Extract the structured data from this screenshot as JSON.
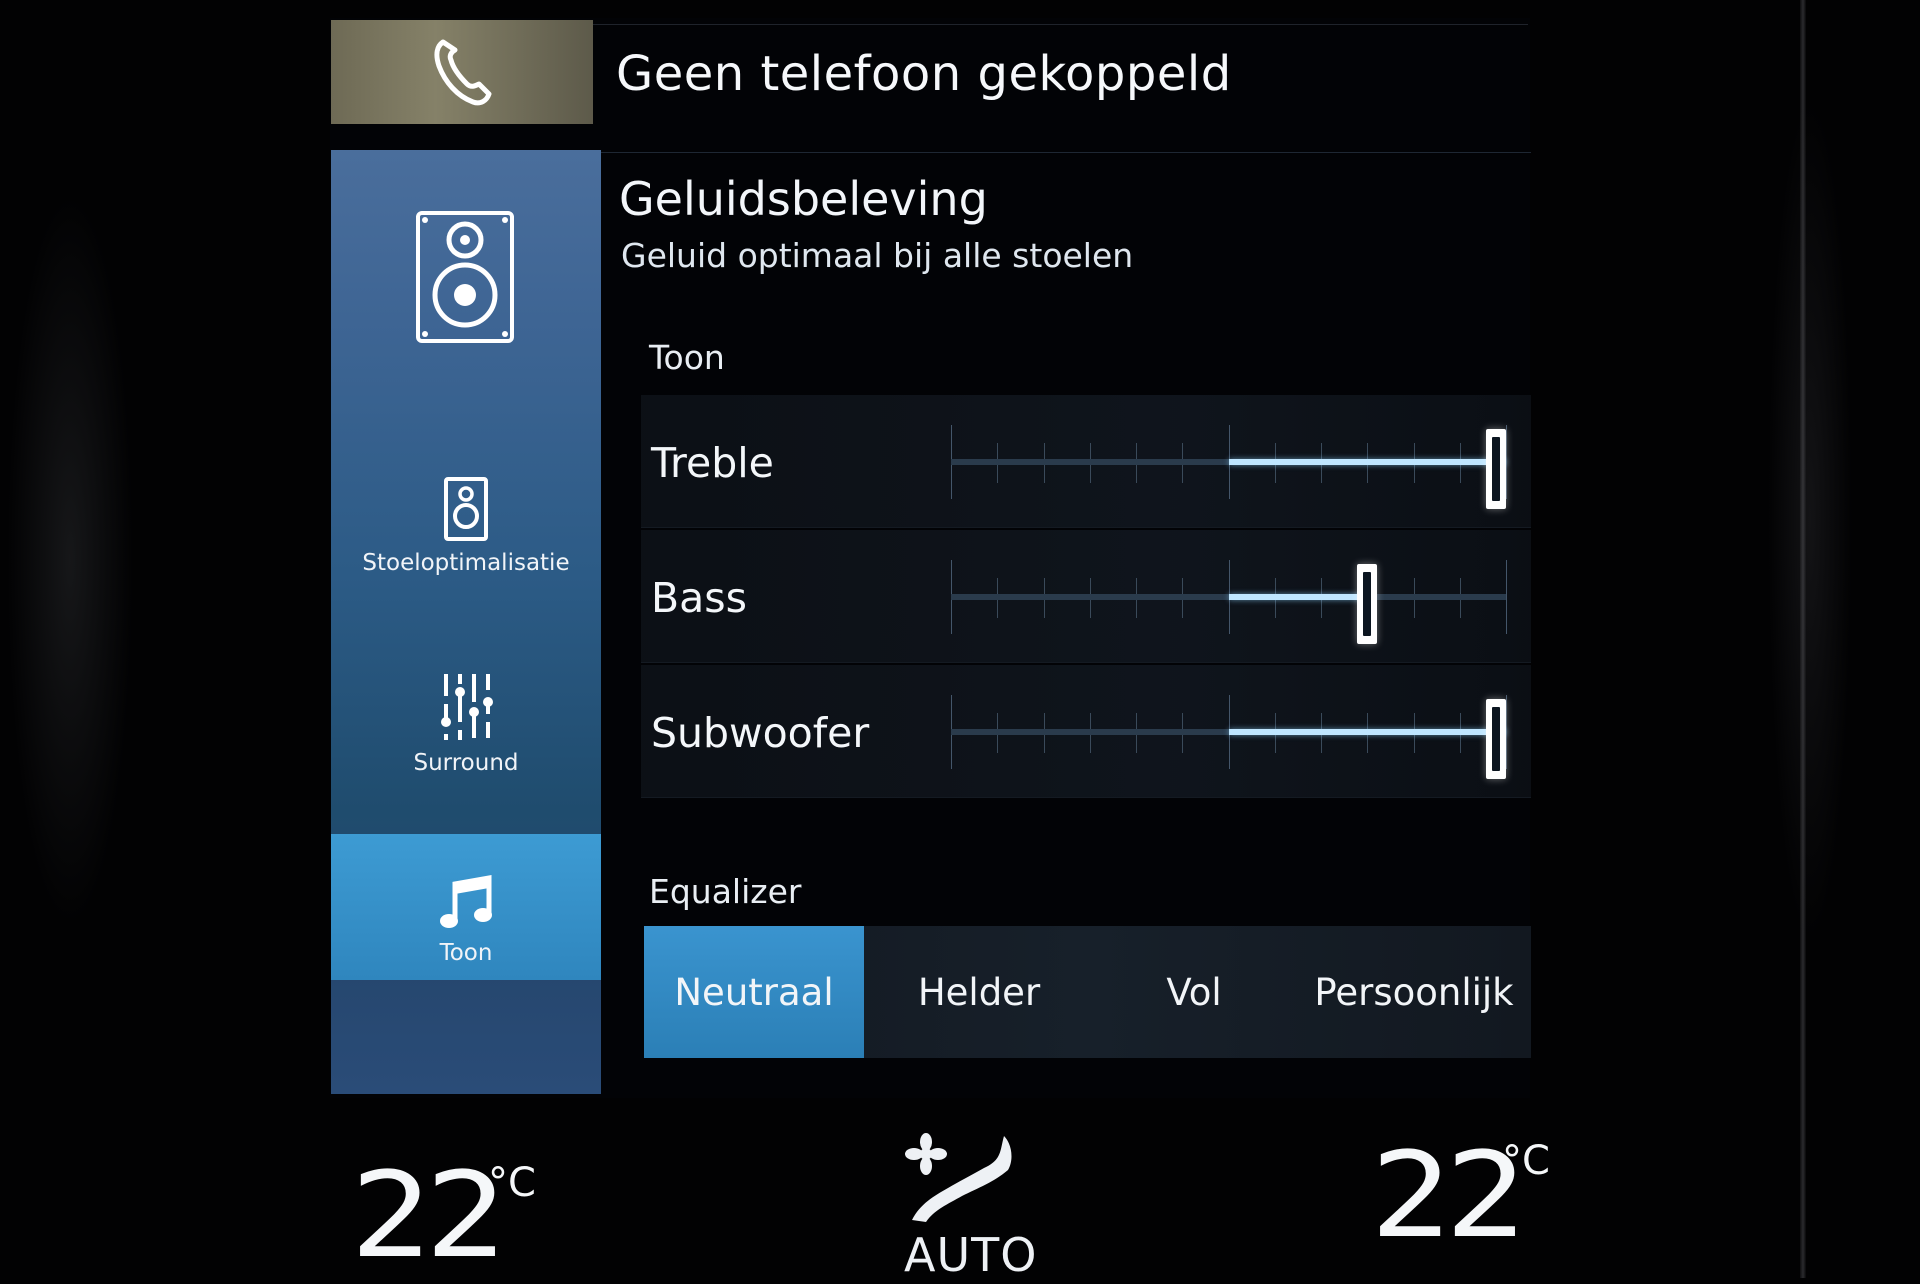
{
  "phone": {
    "status": "Geen telefoon gekoppeld",
    "icon": "phone-icon"
  },
  "nav": {
    "hero_icon": "speaker-icon",
    "items": [
      {
        "label": "Stoeloptimalisatie",
        "icon": "seat-speaker-icon",
        "active": false
      },
      {
        "label": "Surround",
        "icon": "surround-sliders-icon",
        "active": false
      },
      {
        "label": "Toon",
        "icon": "music-note-icon",
        "active": true
      }
    ]
  },
  "header": {
    "title": "Geluidsbeleving",
    "subtitle": "Geluid optimaal bij alle stoelen"
  },
  "tone": {
    "section_label": "Toon",
    "sliders": [
      {
        "label": "Treble",
        "value": 12,
        "min": -12,
        "max": 12
      },
      {
        "label": "Bass",
        "value": 6,
        "min": -12,
        "max": 12
      },
      {
        "label": "Subwoofer",
        "value": 12,
        "min": -12,
        "max": 12
      }
    ]
  },
  "equalizer": {
    "section_label": "Equalizer",
    "options": [
      "Neutraal",
      "Helder",
      "Vol",
      "Persoonlijk"
    ],
    "selected": "Neutraal"
  },
  "climate": {
    "left_temp": "22",
    "left_unit": "°C",
    "right_temp": "22",
    "right_unit": "°C",
    "fan_icon": "climate-airflow-icon",
    "mode_label": "AUTO"
  },
  "colors": {
    "accent": "#3a94cf",
    "slider_fill": "#bfe6ff",
    "nav_top": "#4a6e9c",
    "nav_bottom": "#1f4c6e"
  }
}
